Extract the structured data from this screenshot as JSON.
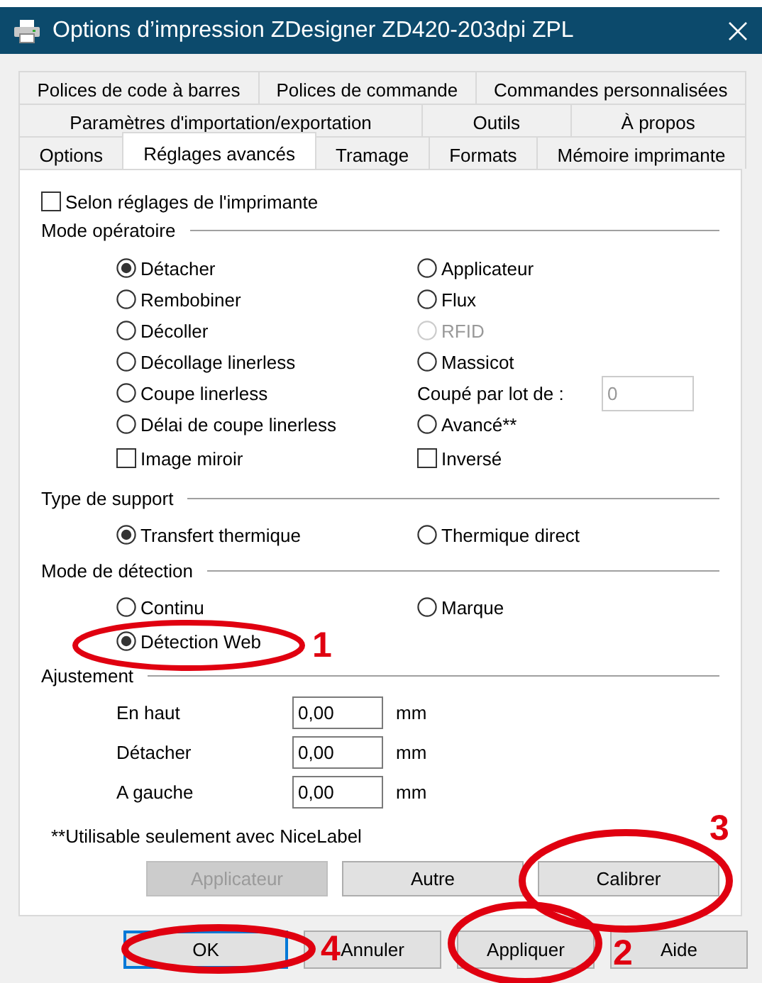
{
  "window": {
    "title": "Options d’impression ZDesigner ZD420-203dpi ZPL"
  },
  "tab_rows": [
    {
      "tabs": [
        {
          "label": "Polices de code à barres",
          "selected": false
        },
        {
          "label": "Polices de commande",
          "selected": false
        },
        {
          "label": "Commandes personnalisées",
          "selected": false
        }
      ]
    },
    {
      "tabs": [
        {
          "label": "Paramètres d'importation/exportation",
          "selected": false
        },
        {
          "label": "Outils",
          "selected": false
        },
        {
          "label": "À propos",
          "selected": false
        }
      ]
    },
    {
      "tabs": [
        {
          "label": "Options",
          "selected": false
        },
        {
          "label": "Réglages avancés",
          "selected": true
        },
        {
          "label": "Tramage",
          "selected": false
        },
        {
          "label": "Formats",
          "selected": false
        },
        {
          "label": "Mémoire imprimante",
          "selected": false
        }
      ]
    }
  ],
  "use_printer_settings": {
    "label": "Selon réglages de l'imprimante",
    "checked": false
  },
  "sections": [
    {
      "title": "Mode opératoire",
      "rows": [
        [
          {
            "kind": "radio",
            "label": "Détacher",
            "selected": true,
            "disabled": false
          },
          {
            "kind": "radio",
            "label": "Applicateur",
            "selected": false,
            "disabled": false
          }
        ],
        [
          {
            "kind": "radio",
            "label": "Rembobiner",
            "selected": false,
            "disabled": false
          },
          {
            "kind": "radio",
            "label": "Flux",
            "selected": false,
            "disabled": false
          }
        ],
        [
          {
            "kind": "radio",
            "label": "Décoller",
            "selected": false,
            "disabled": false
          },
          {
            "kind": "radio",
            "label": "RFID",
            "selected": false,
            "disabled": true
          }
        ],
        [
          {
            "kind": "radio",
            "label": "Décollage linerless",
            "selected": false,
            "disabled": false
          },
          {
            "kind": "radio",
            "label": "Massicot",
            "selected": false,
            "disabled": false
          }
        ],
        [
          {
            "kind": "radio",
            "label": "Coupe linerless",
            "selected": false,
            "disabled": false
          },
          {
            "kind": "field",
            "label": "Coupé par lot de :",
            "value": "0",
            "disabled": true
          }
        ],
        [
          {
            "kind": "radio",
            "label": "Délai de coupe linerless",
            "selected": false,
            "disabled": false
          },
          {
            "kind": "radio",
            "label": "Avancé**",
            "selected": false,
            "disabled": false
          }
        ],
        [
          {
            "kind": "checkbox",
            "label": "Image miroir",
            "checked": false
          },
          {
            "kind": "checkbox",
            "label": "Inversé",
            "checked": false
          }
        ]
      ]
    },
    {
      "title": "Type de support",
      "rows": [
        [
          {
            "kind": "radio",
            "label": "Transfert thermique",
            "selected": true,
            "disabled": false
          },
          {
            "kind": "radio",
            "label": "Thermique direct",
            "selected": false,
            "disabled": false
          }
        ]
      ]
    },
    {
      "title": "Mode de détection",
      "rows": [
        [
          {
            "kind": "radio",
            "label": "Continu",
            "selected": false,
            "disabled": false
          },
          {
            "kind": "radio",
            "label": "Marque",
            "selected": false,
            "disabled": false
          }
        ],
        [
          {
            "kind": "radio",
            "label": "Détection Web",
            "selected": true,
            "disabled": false
          }
        ]
      ]
    },
    {
      "title": "Ajustement",
      "rows": [
        [
          {
            "kind": "measure",
            "label": "En haut",
            "value": "0,00",
            "unit": "mm"
          }
        ],
        [
          {
            "kind": "measure",
            "label": "Détacher",
            "value": "0,00",
            "unit": "mm"
          }
        ],
        [
          {
            "kind": "measure",
            "label": "A gauche",
            "value": "0,00",
            "unit": "mm"
          }
        ]
      ]
    }
  ],
  "note": "**Utilisable seulement avec NiceLabel",
  "action_buttons": [
    {
      "label": "Applicateur",
      "disabled": true
    },
    {
      "label": "Autre",
      "disabled": false
    },
    {
      "label": "Calibrer",
      "disabled": false
    }
  ],
  "dialog_buttons": [
    {
      "label": "OK",
      "focused": true
    },
    {
      "label": "Annuler",
      "focused": false
    },
    {
      "label": "Appliquer",
      "focused": false
    },
    {
      "label": "Aide",
      "focused": false
    }
  ],
  "annotations": [
    {
      "number": "1"
    },
    {
      "number": "2"
    },
    {
      "number": "3"
    },
    {
      "number": "4"
    }
  ]
}
